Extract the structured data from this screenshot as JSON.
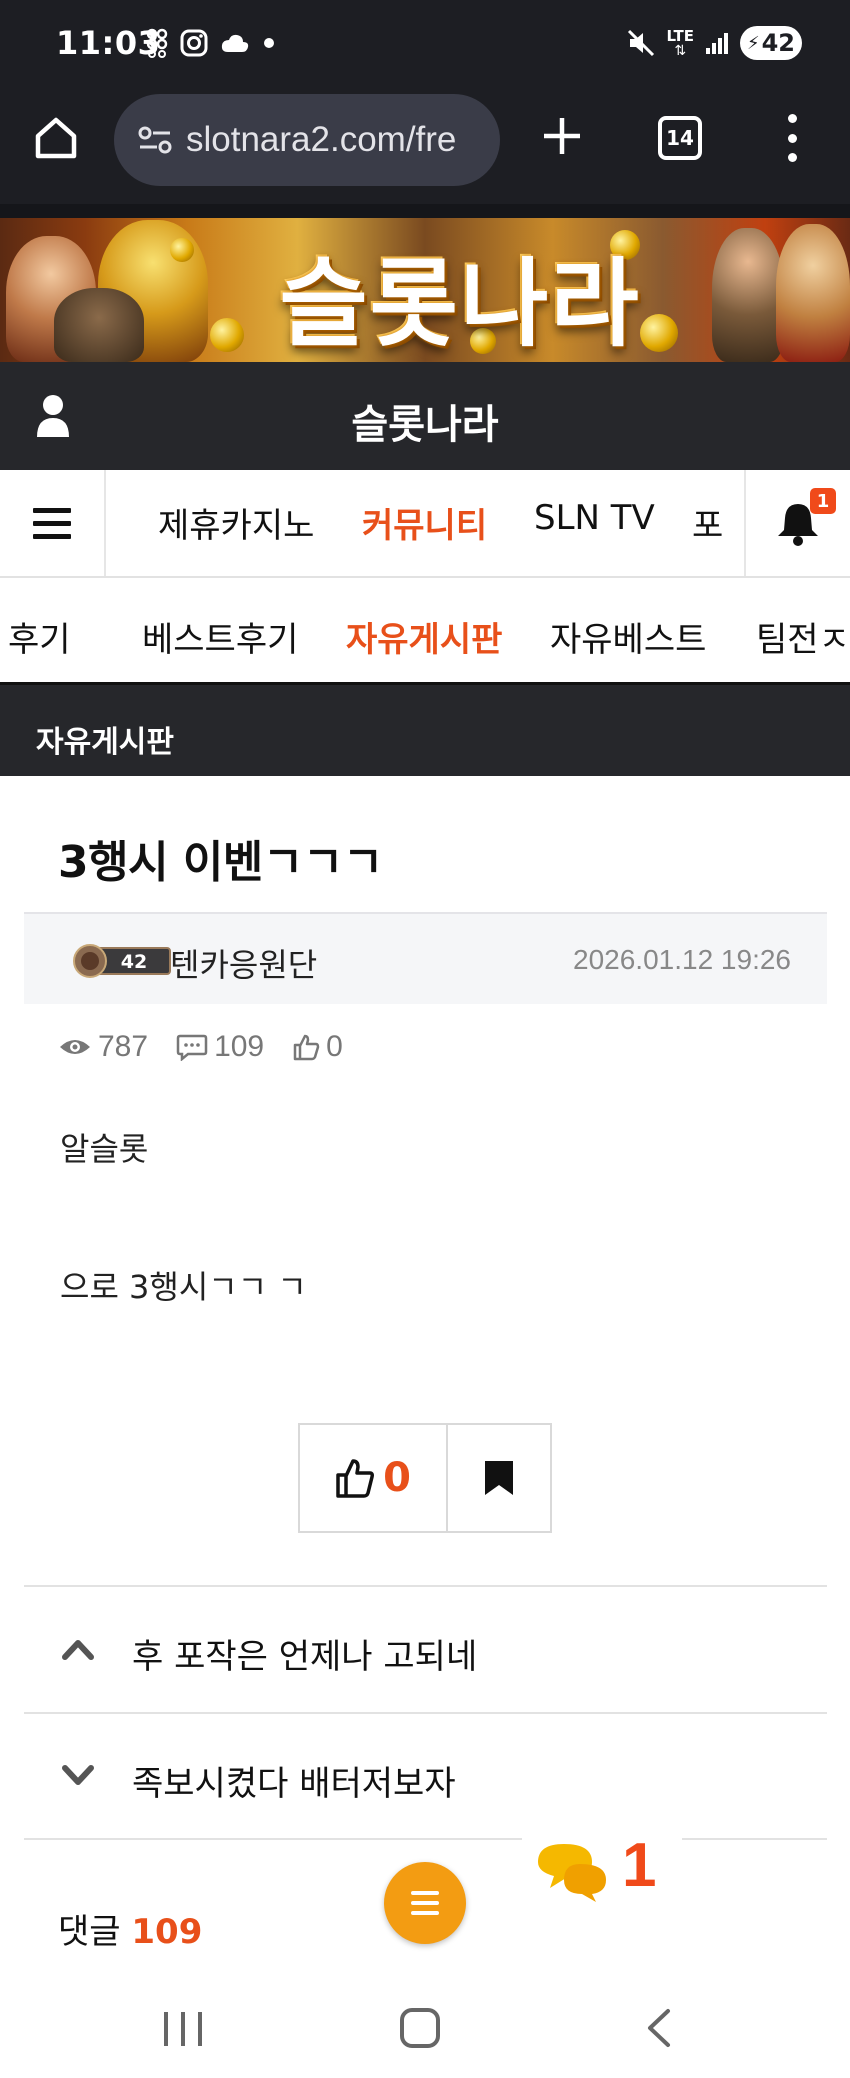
{
  "status_bar": {
    "time": "11:03",
    "network": "LTE",
    "battery": "42",
    "icons": [
      "link-icon",
      "instagram-icon",
      "cloud-icon",
      "dot-icon",
      "mute-icon",
      "lte-icon",
      "signal-icon",
      "battery-icon"
    ]
  },
  "browser": {
    "url": "slotnara2.com/fre",
    "tab_count": "14"
  },
  "banner": {
    "title": "슬롯나라"
  },
  "header": {
    "site_title": "슬롯나라"
  },
  "main_nav": {
    "items": [
      {
        "label": "제휴카지노",
        "active": false
      },
      {
        "label": "커뮤니티",
        "active": true
      },
      {
        "label": "SLN TV",
        "active": false
      },
      {
        "label": "포",
        "active": false
      }
    ],
    "notification_count": "1"
  },
  "sub_nav": {
    "items": [
      {
        "label": "후기",
        "active": false
      },
      {
        "label": "베스트후기",
        "active": false
      },
      {
        "label": "자유게시판",
        "active": true
      },
      {
        "label": "자유베스트",
        "active": false
      },
      {
        "label": "팀전ㅈ",
        "active": false
      }
    ]
  },
  "section": {
    "title": "자유게시판"
  },
  "post": {
    "title": "3행시 이벤ㄱㄱㄱ",
    "author_level": "42",
    "author": "텐카응원단",
    "date": "2026.01.12 19:26",
    "views": "787",
    "comments": "109",
    "likes": "0",
    "body": [
      "알슬롯",
      "으로 3행시ㄱㄱ ㄱ"
    ],
    "like_button_count": "0"
  },
  "navigation": {
    "prev_title": "후 포작은 언제나 고되네",
    "next_title": "족보시켰다 배터저보자"
  },
  "comments": {
    "label": "댓글",
    "count": "109"
  },
  "chat_float": {
    "count": "1"
  },
  "colors": {
    "accent": "#e8501a",
    "dark_bar": "#26272b",
    "fab": "#f39c12"
  }
}
